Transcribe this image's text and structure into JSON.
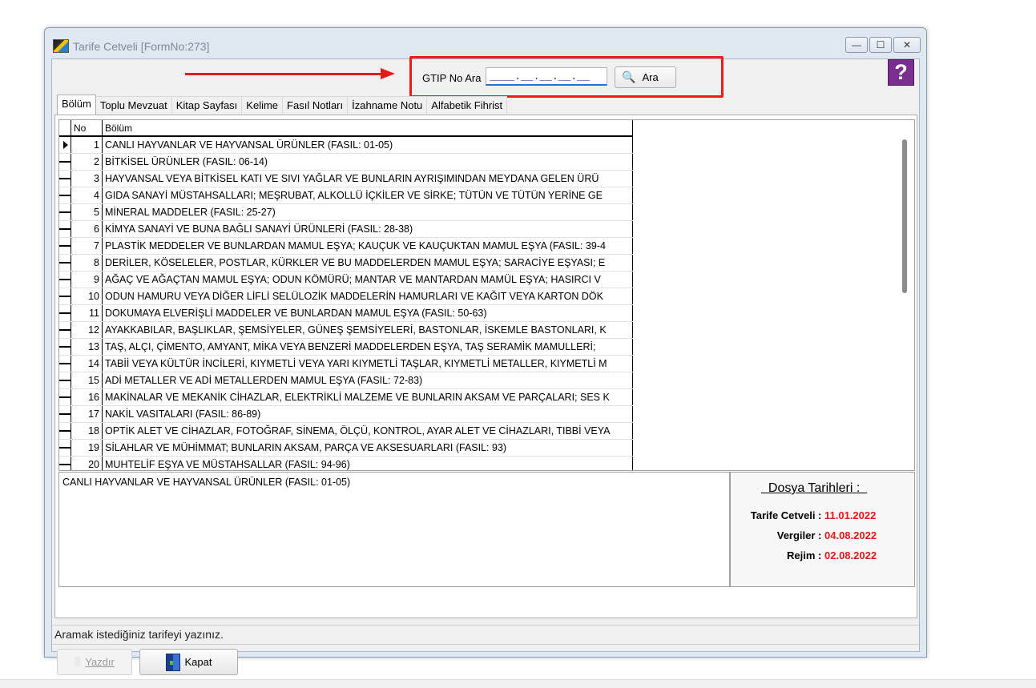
{
  "window": {
    "title": "Tarife Cetveli [FormNo:273]",
    "controls": {
      "minimize": "—",
      "maximize": "☐",
      "close": "✕"
    }
  },
  "search": {
    "label": "GTIP No Ara",
    "value": "____.__.__.__.__",
    "button_label": "Ara"
  },
  "help": {
    "label": "?"
  },
  "tabs": [
    {
      "label": "Bölüm",
      "active": true
    },
    {
      "label": "Toplu Mevzuat"
    },
    {
      "label": "Kitap Sayfası"
    },
    {
      "label": "Kelime"
    },
    {
      "label": "Fasıl Notları"
    },
    {
      "label": "İzahname Notu"
    },
    {
      "label": "Alfabetik Fihrist"
    }
  ],
  "grid": {
    "columns": {
      "no": "No",
      "bolum": "Bölüm"
    },
    "rows": [
      {
        "no": "1",
        "text": "CANLI HAYVANLAR VE HAYVANSAL ÜRÜNLER (FASIL: 01-05)"
      },
      {
        "no": "2",
        "text": "BİTKİSEL ÜRÜNLER (FASIL: 06-14)"
      },
      {
        "no": "3",
        "text": "HAYVANSAL VEYA BİTKİSEL KATI VE SIVI YAĞLAR VE BUNLARIN AYRIŞIMINDAN MEYDANA GELEN ÜRÜ"
      },
      {
        "no": "4",
        "text": "GIDA SANAYİ MÜSTAHSALLARI; MEŞRUBAT, ALKOLLÜ İÇKİLER VE SİRKE; TÜTÜN VE TÜTÜN YERİNE GE"
      },
      {
        "no": "5",
        "text": "MİNERAL MADDELER (FASIL: 25-27)"
      },
      {
        "no": "6",
        "text": "KİMYA SANAYİ VE BUNA BAĞLI SANAYİ ÜRÜNLERİ (FASIL: 28-38)"
      },
      {
        "no": "7",
        "text": "PLASTİK MEDDELER VE BUNLARDAN MAMUL EŞYA; KAUÇUK VE KAUÇUKTAN MAMUL EŞYA (FASIL: 39-4"
      },
      {
        "no": "8",
        "text": "DERİLER, KÖSELELER, POSTLAR, KÜRKLER VE BU MADDELERDEN MAMUL EŞYA; SARACİYE EŞYASI; E"
      },
      {
        "no": "9",
        "text": "AĞAÇ VE AĞAÇTAN MAMUL EŞYA; ODUN KÖMÜRÜ; MANTAR VE MANTARDAN MAMÜL EŞYA; HASIRCI V"
      },
      {
        "no": "10",
        "text": "ODUN HAMURU VEYA DİĞER LİFLİ SELÜLOZİK MADDELERİN HAMURLARI VE KAĞIT VEYA KARTON DÖK"
      },
      {
        "no": "11",
        "text": "DOKUMAYA ELVERİŞLİ MADDELER VE BUNLARDAN MAMUL EŞYA (FASIL: 50-63)"
      },
      {
        "no": "12",
        "text": "AYAKKABILAR, BAŞLIKLAR, ŞEMSİYELER, GÜNEŞ ŞEMSİYELERİ, BASTONLAR, İSKEMLE BASTONLARI, K"
      },
      {
        "no": "13",
        "text": "TAŞ, ALÇI, ÇİMENTO, AMYANT, MİKA VEYA BENZERİ MADDELERDEN EŞYA, TAŞ SERAMİK MAMULLERİ;"
      },
      {
        "no": "14",
        "text": "TABİİ VEYA KÜLTÜR İNCİLERİ, KIYMETLİ VEYA YARI KIYMETLİ TAŞLAR, KIYMETLİ METALLER, KIYMETLİ M"
      },
      {
        "no": "15",
        "text": "ADİ METALLER VE ADİ METALLERDEN MAMUL EŞYA (FASIL: 72-83)"
      },
      {
        "no": "16",
        "text": "MAKİNALAR VE MEKANİK CİHAZLAR, ELEKTRİKLİ MALZEME VE BUNLARIN AKSAM VE PARÇALARI; SES K"
      },
      {
        "no": "17",
        "text": "NAKİL VASITALARI (FASIL: 86-89)"
      },
      {
        "no": "18",
        "text": "OPTİK ALET VE CİHAZLAR, FOTOĞRAF, SİNEMA, ÖLÇÜ, KONTROL, AYAR ALET VE CİHAZLARI, TIBBİ VEYA"
      },
      {
        "no": "19",
        "text": "SİLAHLAR VE MÜHİMMAT; BUNLARIN AKSAM, PARÇA VE AKSESUARLARI (FASIL: 93)"
      },
      {
        "no": "20",
        "text": "MUHTELİF EŞYA VE MÜSTAHSALLAR (FASIL: 94-96)"
      }
    ]
  },
  "description": "CANLI HAYVANLAR VE HAYVANSAL ÜRÜNLER (FASIL: 01-05)",
  "dates": {
    "title": "  Dosya Tarihleri :  ",
    "items": [
      {
        "label": "Tarife Cetveli :",
        "value": "11.01.2022"
      },
      {
        "label": "Vergiler :",
        "value": "04.08.2022"
      },
      {
        "label": "Rejim :",
        "value": "02.08.2022"
      }
    ]
  },
  "status": "Aramak istediğiniz tarifeyi yazınız.",
  "buttons": {
    "print": "Yazdır",
    "close": "Kapat"
  },
  "colors": {
    "highlight": "#ef1b1b",
    "date_value": "#e01818",
    "help_bg": "#7a2e8f"
  }
}
